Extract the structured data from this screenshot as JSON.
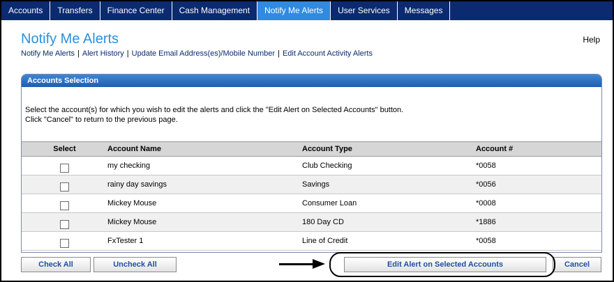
{
  "nav": {
    "tabs": [
      {
        "label": "Accounts"
      },
      {
        "label": "Transfers"
      },
      {
        "label": "Finance Center"
      },
      {
        "label": "Cash Management"
      },
      {
        "label": "Notify Me Alerts"
      },
      {
        "label": "User Services"
      },
      {
        "label": "Messages"
      }
    ],
    "active_tab": "Notify Me Alerts"
  },
  "header": {
    "title": "Notify Me Alerts",
    "help": "Help"
  },
  "sublinks": [
    {
      "label": "Notify Me Alerts"
    },
    {
      "label": "Alert History"
    },
    {
      "label": "Update Email Address(es)/Mobile Number"
    },
    {
      "label": "Edit Account Activity Alerts"
    }
  ],
  "panel": {
    "title": "Accounts Selection",
    "instruction_line1": "Select the account(s) for which you wish to edit the alerts and click the \"Edit Alert on Selected Accounts\" button.",
    "instruction_line2": "Click \"Cancel\" to return to the previous page."
  },
  "table": {
    "columns": {
      "select": "Select",
      "name": "Account Name",
      "type": "Account Type",
      "number": "Account #"
    },
    "rows": [
      {
        "name": "my checking",
        "type": "Club Checking",
        "number": "*0058",
        "checked": false
      },
      {
        "name": "rainy day savings",
        "type": "Savings",
        "number": "*0056",
        "checked": false
      },
      {
        "name": "Mickey Mouse",
        "type": "Consumer Loan",
        "number": "*0008",
        "checked": false
      },
      {
        "name": "Mickey Mouse",
        "type": "180 Day CD",
        "number": "*1886",
        "checked": false
      },
      {
        "name": "FxTester 1",
        "type": "Line of Credit",
        "number": "*0058",
        "checked": false
      }
    ]
  },
  "buttons": {
    "check_all": "Check All",
    "uncheck_all": "Uncheck All",
    "edit_alert": "Edit Alert on Selected Accounts",
    "cancel": "Cancel"
  },
  "colors": {
    "nav_bg": "#0b2a6f",
    "nav_active": "#2f8ae0",
    "title": "#2e8fdb",
    "panel_header": "#1f5db0",
    "button_text": "#1f4f9e"
  },
  "annotation": {
    "arrow_icon": "arrow-right-icon",
    "highlight": "oval-highlight"
  }
}
